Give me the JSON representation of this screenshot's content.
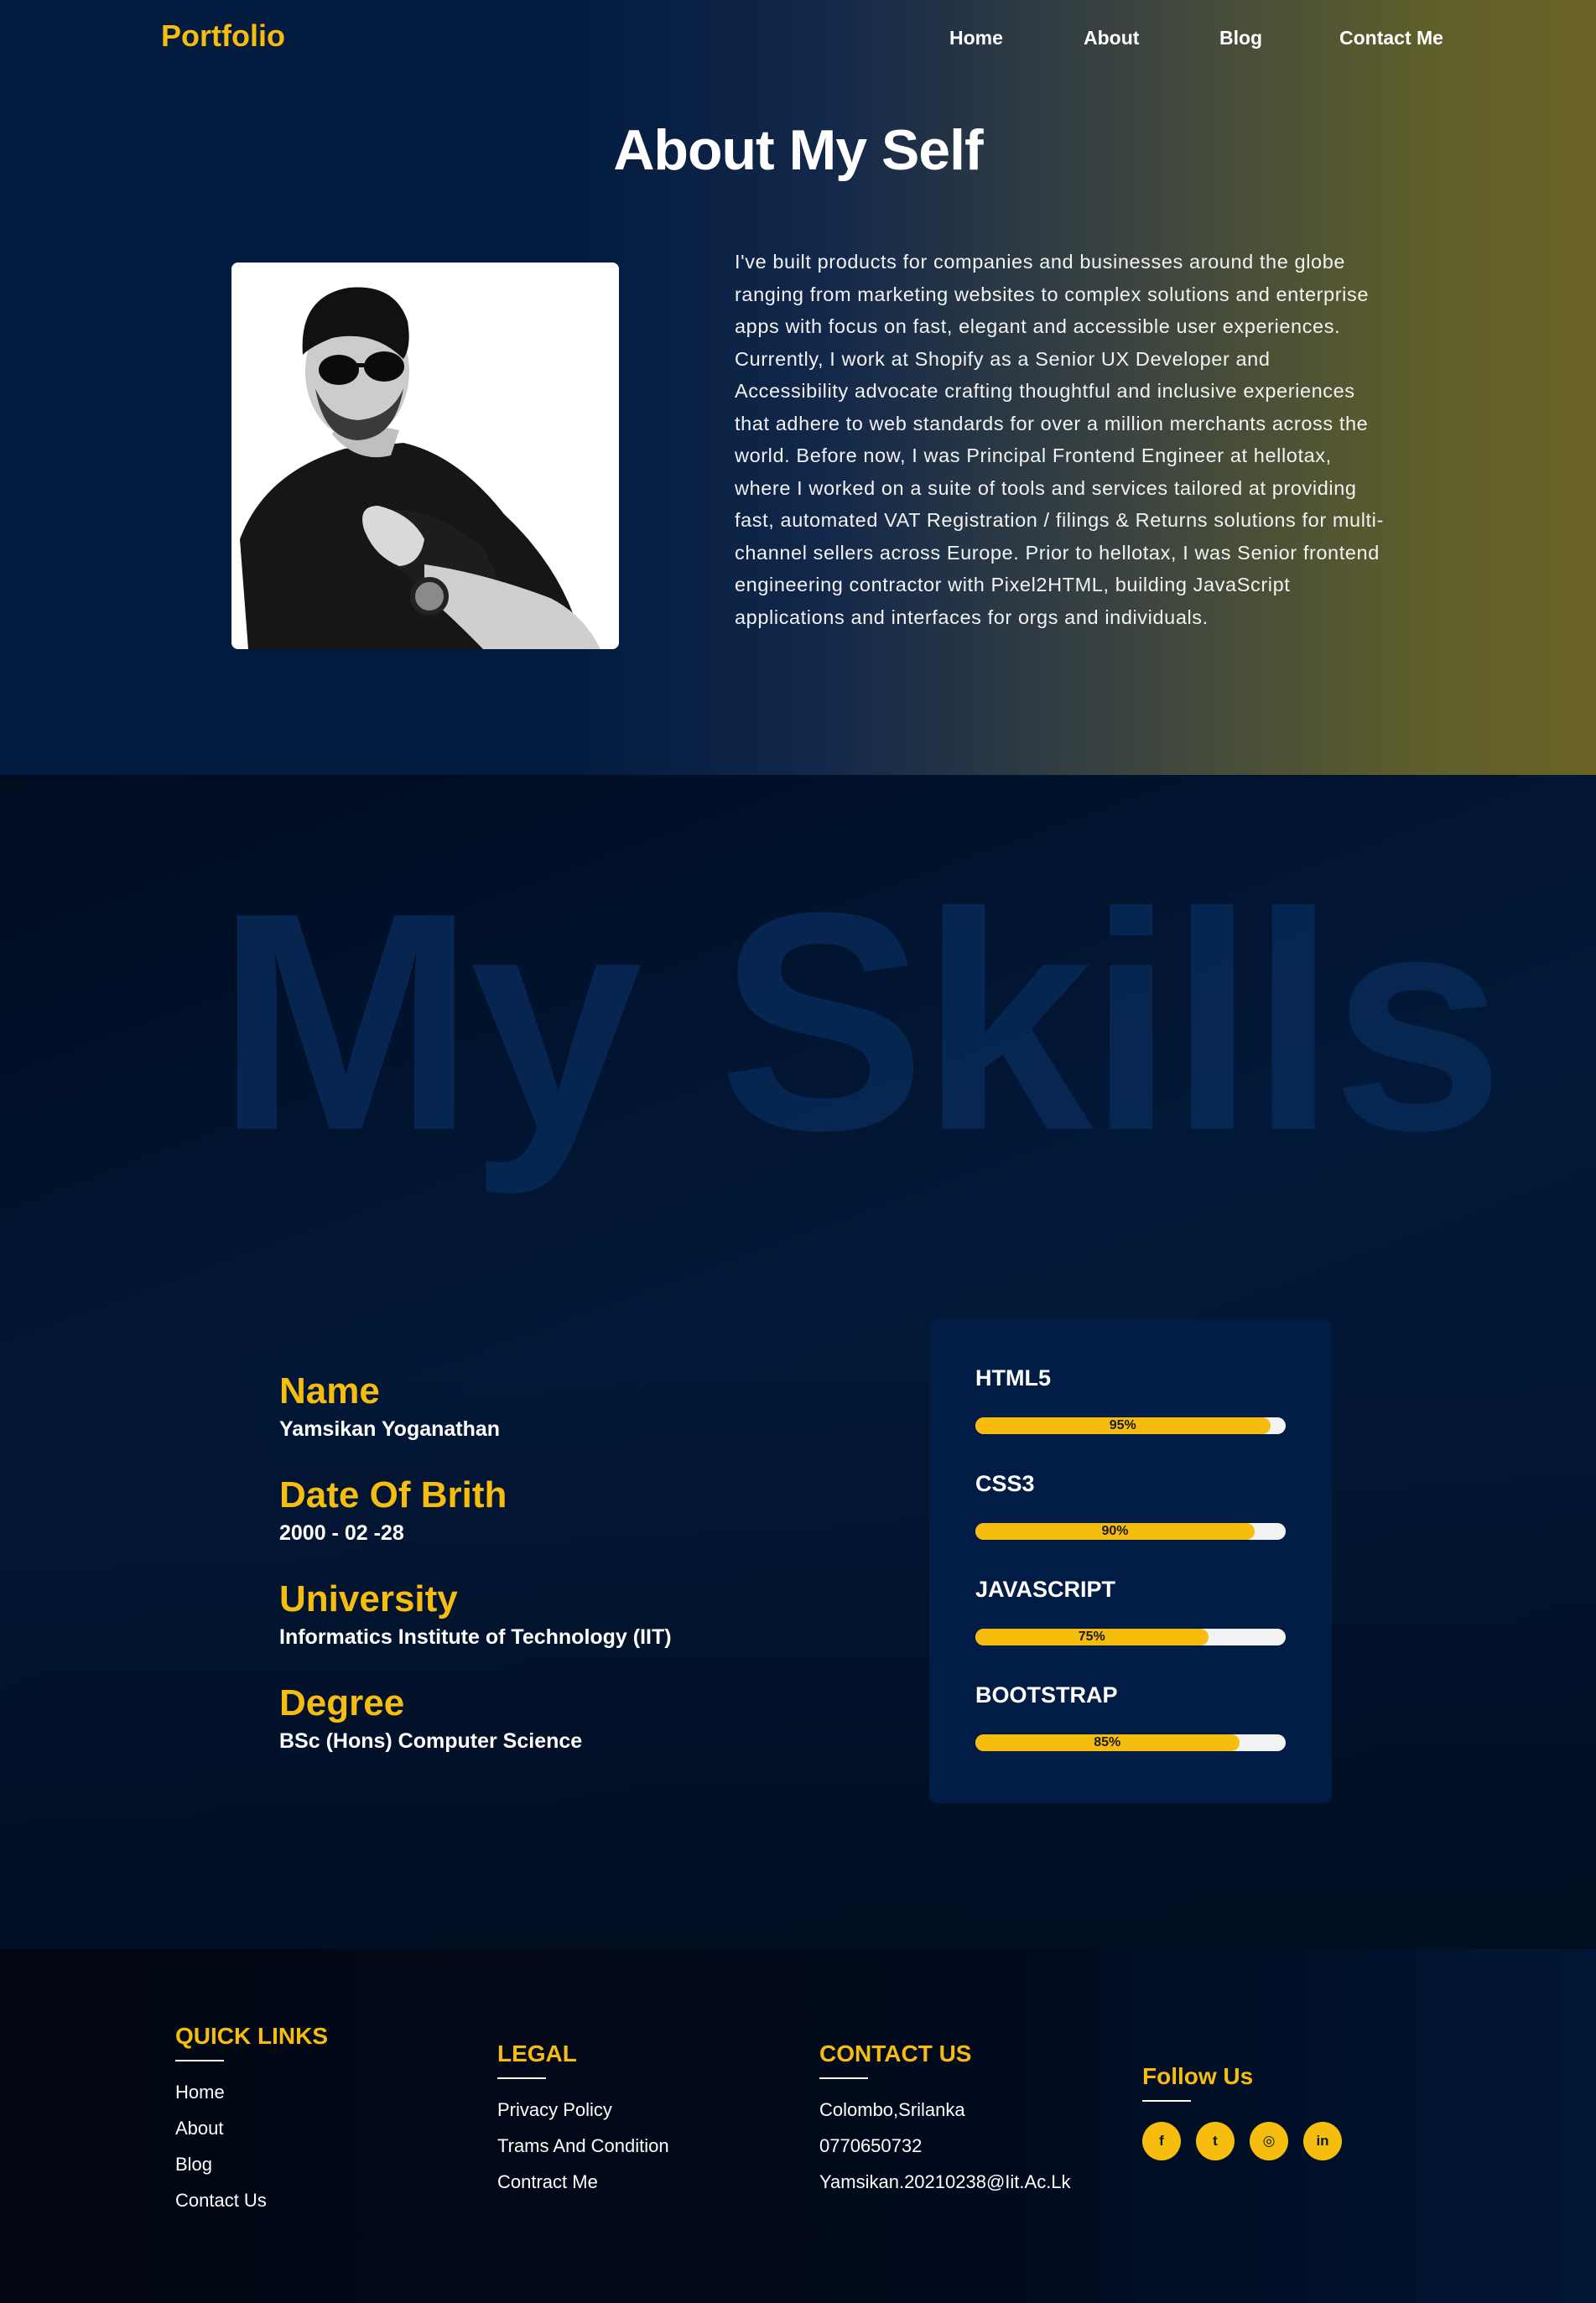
{
  "colors": {
    "accent": "#f6bd0f",
    "card_bg": "#021d45",
    "text": "#ffffff"
  },
  "nav": {
    "logo": "Portfolio",
    "links": [
      "Home",
      "About",
      "Blog",
      "Contact Me"
    ]
  },
  "about": {
    "title": "About My Self",
    "photo_icon": "profile-photo",
    "text": "I've built products for companies and businesses around the globe ranging from marketing websites to complex solutions and enterprise apps with focus on fast, elegant and accessible user experiences. Currently, I work at Shopify as a Senior UX Developer and Accessibility advocate crafting thoughtful and inclusive experiences that adhere to web standards for over a million merchants across the world. Before now, I was Principal Frontend Engineer at hellotax, where I worked on a suite of tools and services tailored at providing fast, automated VAT Registration / filings & Returns solutions for multi-channel sellers across Europe. Prior to hellotax, I was Senior frontend engineering contractor with Pixel2HTML, building JavaScript applications and interfaces for orgs and individuals."
  },
  "skills": {
    "background_word": "My Skills",
    "info": [
      {
        "label": "Name",
        "value": "Yamsikan Yoganathan"
      },
      {
        "label": "Date Of Brith",
        "value": "2000 - 02 -28"
      },
      {
        "label": "University",
        "value": "Informatics Institute of Technology (IIT)"
      },
      {
        "label": "Degree",
        "value": "BSc (Hons) Computer Science"
      }
    ],
    "bars": [
      {
        "name": "HTML5",
        "percent": 95,
        "label": "95%"
      },
      {
        "name": "CSS3",
        "percent": 90,
        "label": "90%"
      },
      {
        "name": "JAVASCRIPT",
        "percent": 75,
        "label": "75%"
      },
      {
        "name": "BOOTSTRAP",
        "percent": 85,
        "label": "85%"
      }
    ]
  },
  "footer": {
    "quick_links": {
      "title": "QUICK LINKS",
      "items": [
        "Home",
        "About",
        "Blog",
        "Contact Us"
      ]
    },
    "legal": {
      "title": "LEGAL",
      "items": [
        "Privacy Policy",
        "Trams And Condition",
        "Contract Me"
      ]
    },
    "contact": {
      "title": "CONTACT US",
      "items": [
        "Colombo,Srilanka",
        "0770650732",
        "Yamsikan.20210238@Iit.Ac.Lk"
      ]
    },
    "follow": {
      "title": "Follow Us",
      "icons": [
        {
          "name": "facebook-icon",
          "glyph": "f"
        },
        {
          "name": "twitter-icon",
          "glyph": "t"
        },
        {
          "name": "instagram-icon",
          "glyph": "◎"
        },
        {
          "name": "linkedin-icon",
          "glyph": "in"
        }
      ]
    }
  }
}
